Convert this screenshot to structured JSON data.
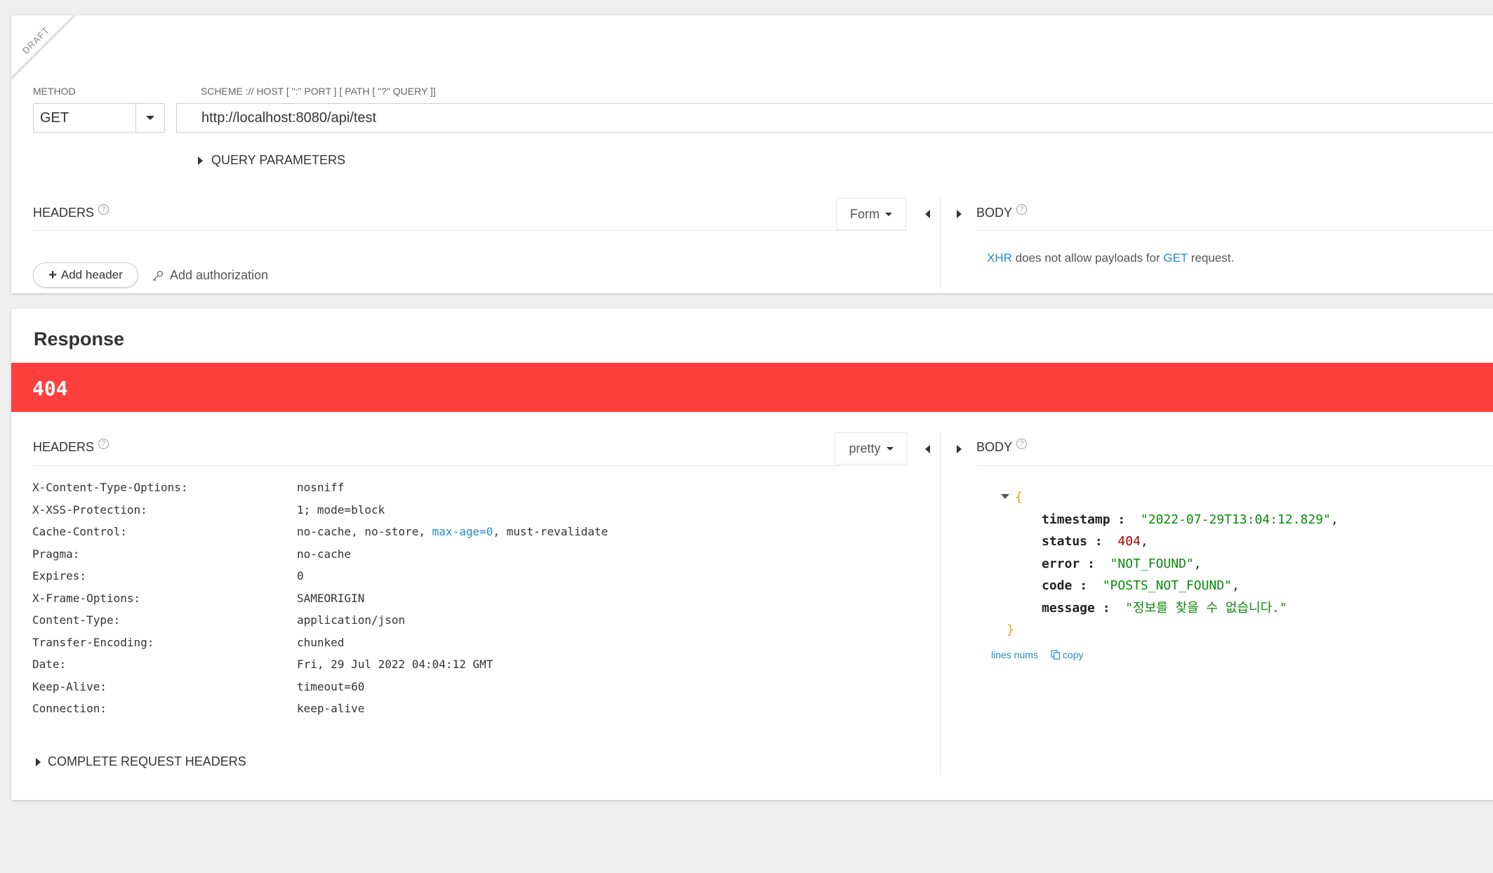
{
  "request": {
    "draft_label": "DRAFT",
    "method_label": "METHOD",
    "method_value": "GET",
    "url_label": "SCHEME :// HOST [ \":\" PORT ] [ PATH [ \"?\" QUERY ]]",
    "url_value": "http://localhost:8080/api/test",
    "query_params_label": "QUERY PARAMETERS",
    "headers_title": "HEADERS",
    "headers_mode": "Form",
    "add_header_label": "Add header",
    "add_auth_label": "Add authorization",
    "body_title": "BODY",
    "body_msg_pre": "XHR",
    "body_msg_mid1": " does not allow payloads for ",
    "body_msg_method": "GET",
    "body_msg_post": " request."
  },
  "response": {
    "title": "Response",
    "status_code": "404",
    "status_color": "#ff3e3e",
    "headers_title": "HEADERS",
    "headers_mode": "pretty",
    "headers": [
      {
        "key": "X-Content-Type-Options:",
        "value": "nosniff"
      },
      {
        "key": "X-XSS-Protection:",
        "value": "1; mode=block"
      },
      {
        "key": "Cache-Control:",
        "value_pre": "no-cache, no-store, ",
        "value_link": "max-age=0",
        "value_post": ", must-revalidate"
      },
      {
        "key": "Pragma:",
        "value": "no-cache"
      },
      {
        "key": "Expires:",
        "value": "0"
      },
      {
        "key": "X-Frame-Options:",
        "value": "SAMEORIGIN"
      },
      {
        "key": "Content-Type:",
        "value": "application/json"
      },
      {
        "key": "Transfer-Encoding:",
        "value": "chunked"
      },
      {
        "key": "Date:",
        "value": "Fri, 29 Jul 2022 04:04:12 GMT"
      },
      {
        "key": "Keep-Alive:",
        "value": "timeout=60"
      },
      {
        "key": "Connection:",
        "value": "keep-alive"
      }
    ],
    "complete_headers_label": "COMPLETE REQUEST HEADERS",
    "body_title": "BODY",
    "json": {
      "open": "{",
      "close": "}",
      "fields": [
        {
          "key": "timestamp",
          "value": "\"2022-07-29T13:04:12.829\"",
          "type": "string"
        },
        {
          "key": "status",
          "value": "404",
          "type": "number"
        },
        {
          "key": "error",
          "value": "\"NOT_FOUND\"",
          "type": "string"
        },
        {
          "key": "code",
          "value": "\"POSTS_NOT_FOUND\"",
          "type": "string"
        },
        {
          "key": "message",
          "value": "\"정보를 찾을 수 없습니다.\"",
          "type": "string"
        }
      ]
    },
    "lines_nums_label": "lines nums",
    "copy_label": "copy"
  }
}
